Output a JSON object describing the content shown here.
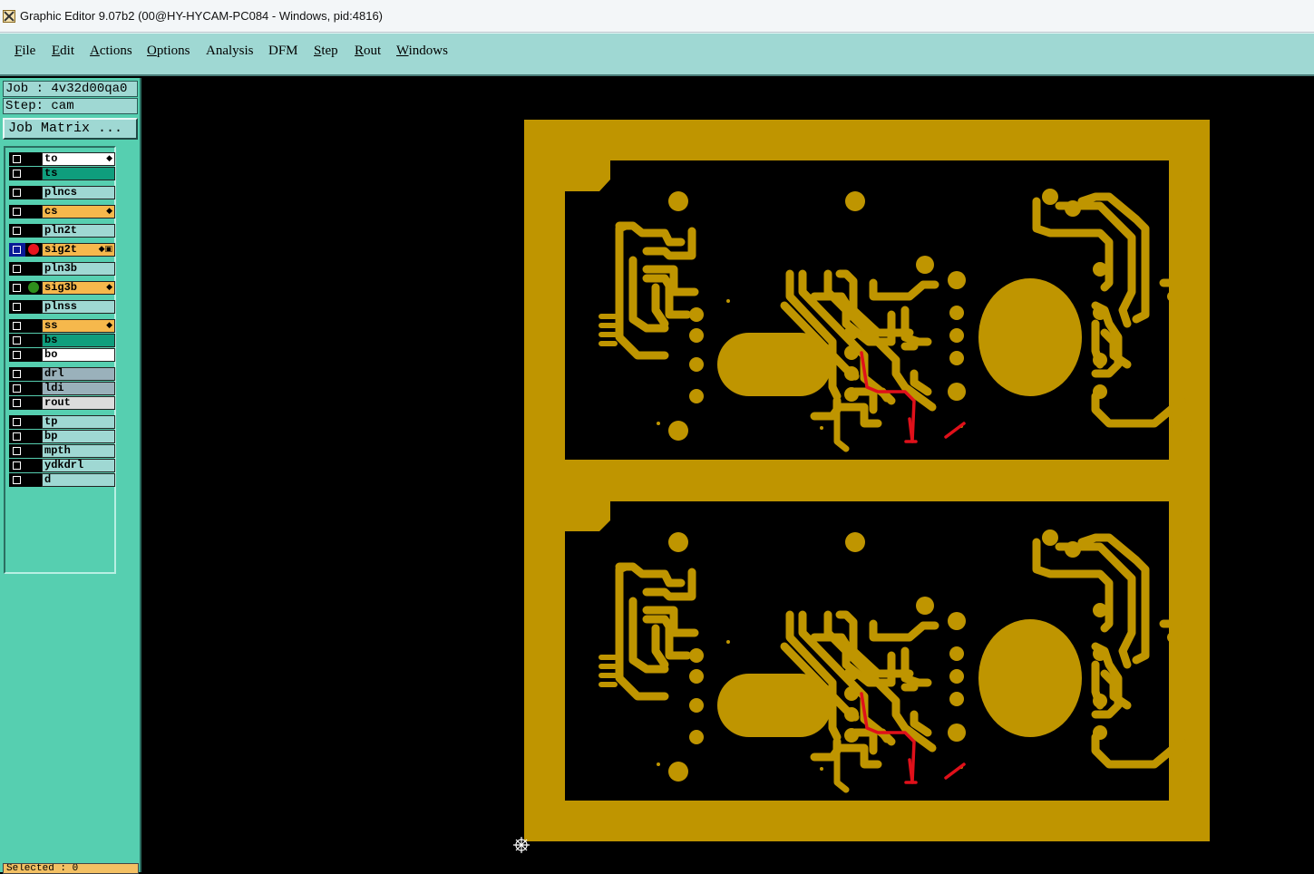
{
  "window": {
    "title": "Graphic Editor 9.07b2 (00@HY-HYCAM-PC084 - Windows, pid:4816)"
  },
  "menu": [
    {
      "label": "File",
      "underline": "F",
      "rest": "ile"
    },
    {
      "label": "Edit",
      "underline": "E",
      "rest": "dit"
    },
    {
      "label": "Actions",
      "underline": "A",
      "rest": "ctions"
    },
    {
      "label": "Options",
      "underline": "O",
      "rest": "ptions"
    },
    {
      "label": "Analysis",
      "underline": "",
      "rest": "Analysis"
    },
    {
      "label": "DFM",
      "underline": "",
      "rest": "DFM"
    },
    {
      "label": "Step",
      "underline": "S",
      "rest": "tep"
    },
    {
      "label": "Rout",
      "underline": "R",
      "rest": "out"
    },
    {
      "label": "Windows",
      "underline": "W",
      "rest": "indows"
    }
  ],
  "job": {
    "label": "Job : 4v32d00qa0",
    "step": "Step: cam",
    "matrix_button": "Job Matrix ..."
  },
  "layers": [
    {
      "name": "to",
      "color": "#ffffff",
      "flag": "◆"
    },
    {
      "name": "ts",
      "color": "#0f9e7d",
      "flag": ""
    },
    {
      "name": "plncs",
      "color": "#9fd8d3",
      "flag": ""
    },
    {
      "name": "cs",
      "color": "#f6b84c",
      "flag": "◆"
    },
    {
      "name": "pln2t",
      "color": "#9fd8d3",
      "flag": ""
    },
    {
      "name": "sig2t",
      "color": "#f6b84c",
      "flag": "◆▣",
      "dot": "#e8141e",
      "active": true
    },
    {
      "name": "pln3b",
      "color": "#9fd8d3",
      "flag": ""
    },
    {
      "name": "sig3b",
      "color": "#f6b84c",
      "flag": "◆",
      "dot": "#2e8f1c"
    },
    {
      "name": "plnss",
      "color": "#9fd8d3",
      "flag": ""
    },
    {
      "name": "ss",
      "color": "#f6b84c",
      "flag": "◆"
    },
    {
      "name": "bs",
      "color": "#0f9e7d",
      "flag": ""
    },
    {
      "name": "bo",
      "color": "#ffffff",
      "flag": ""
    },
    {
      "name": "drl",
      "color": "#9ab1bb",
      "flag": ""
    },
    {
      "name": "ldi",
      "color": "#9ab1bb",
      "flag": ""
    },
    {
      "name": "rout",
      "color": "#dcdcdc",
      "flag": ""
    },
    {
      "name": "tp",
      "color": "#9fd8d3",
      "flag": ""
    },
    {
      "name": "bp",
      "color": "#9fd8d3",
      "flag": ""
    },
    {
      "name": "mpth",
      "color": "#9fd8d3",
      "flag": ""
    },
    {
      "name": "ydkdrl",
      "color": "#9fd8d3",
      "flag": ""
    },
    {
      "name": "d",
      "color": "#9fd8d3",
      "flag": ""
    }
  ],
  "status": {
    "selected": "Selected : 0"
  },
  "colors": {
    "copper": "#bf9500",
    "trace_red": "#e0101a",
    "background": "#000000"
  }
}
